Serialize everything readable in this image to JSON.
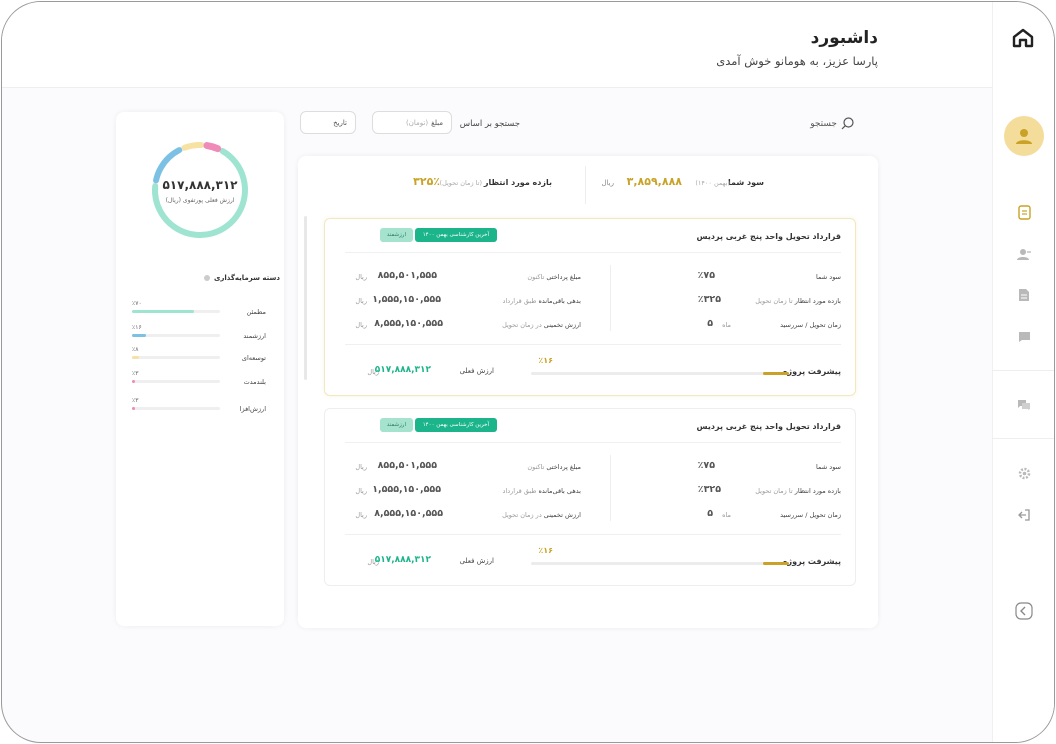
{
  "header": {
    "title": "داشبورد",
    "welcome": "پارسا عزیز، به هومانو خوش آمدی"
  },
  "search": {
    "label": "جستجو",
    "basis_label": "جستجو بر اساس",
    "amount_label": "مبلغ",
    "amount_placeholder": "(تومان)",
    "date_label": "تاریخ"
  },
  "summary": {
    "profit_label": "سود شما",
    "profit_note": "(بهمن ۱۴۰۰)",
    "profit_value": "۳,۸۵۹,۸۸۸",
    "profit_unit": "ریال",
    "return_label": "بازده مورد انتظار",
    "return_note": "(تا زمان تحویل)",
    "return_value": "۳۲۵٪"
  },
  "cards": [
    {
      "title": "قرارداد تحویل واحد پنج غربی پردیس",
      "badge_status": "آخرین کارشناسی بهمن ۱۴۰۰",
      "badge_type": "ارزشمند",
      "profit_label": "سود شما",
      "profit_value": "٪۷۵",
      "return_label": "بازده مورد انتظار",
      "return_note": "تا زمان تحویل",
      "return_value": "٪۳۲۵",
      "delivery_label": "زمان تحویل / سررسید",
      "delivery_value": "۵",
      "delivery_unit": "ماه",
      "paid_label": "مبلغ پرداختی",
      "paid_note": "تاکنون",
      "paid_value": "۸۵۵,۵۰۱,۵۵۵",
      "debt_label": "بدهی باقی‌مانده",
      "debt_note": "طبق قرارداد",
      "debt_value": "۱,۵۵۵,۱۵۰,۵۵۵",
      "estimate_label": "ارزش تخمینی",
      "estimate_note": "در زمان تحویل",
      "estimate_value": "۸,۵۵۵,۱۵۰,۵۵۵",
      "unit": "ریال",
      "progress_label": "پیشرفت پروژه",
      "progress_pct": "٪۱۶",
      "progress_fraction": 0.1,
      "current_label": "ارزش فعلی",
      "current_value": "۵۱۷,۸۸۸,۳۱۲"
    },
    {
      "title": "قرارداد تحویل واحد پنج غربی پردیس",
      "badge_status": "آخرین کارشناسی بهمن ۱۴۰۰",
      "badge_type": "ارزشمند",
      "profit_label": "سود شما",
      "profit_value": "٪۷۵",
      "return_label": "بازده مورد انتظار",
      "return_note": "تا زمان تحویل",
      "return_value": "٪۳۲۵",
      "delivery_label": "زمان تحویل / سررسید",
      "delivery_value": "۵",
      "delivery_unit": "ماه",
      "paid_label": "مبلغ پرداختی",
      "paid_note": "تاکنون",
      "paid_value": "۸۵۵,۵۰۱,۵۵۵",
      "debt_label": "بدهی باقی‌مانده",
      "debt_note": "طبق قرارداد",
      "debt_value": "۱,۵۵۵,۱۵۰,۵۵۵",
      "estimate_label": "ارزش تخمینی",
      "estimate_note": "در زمان تحویل",
      "estimate_value": "۸,۵۵۵,۱۵۰,۵۵۵",
      "unit": "ریال",
      "progress_label": "پیشرفت پروژه",
      "progress_pct": "٪۱۶",
      "progress_fraction": 0.1,
      "current_label": "ارزش فعلی",
      "current_value": "۵۱۷,۸۸۸,۳۱۲"
    }
  ],
  "portfolio": {
    "value": "۵۱۷,۸۸۸,۳۱۲",
    "caption": "ارزش فعلی پورتفوی (ریال)",
    "category_title": "دسته سرمایه‌گذاری",
    "categories": [
      {
        "name": "مطمئن",
        "pct": "٪۷۰",
        "value": 0.7,
        "color": "#9ee4d1"
      },
      {
        "name": "ارزشمند",
        "pct": "٪۱۶",
        "value": 0.16,
        "color": "#7cc1e4"
      },
      {
        "name": "توسعه‌ای",
        "pct": "٪۸",
        "value": 0.08,
        "color": "#f6e3a3"
      },
      {
        "name": "بلندمدت",
        "pct": "٪۳",
        "value": 0.03,
        "color": "#f08ab8"
      },
      {
        "name": "ارزش‌افزا",
        "pct": "٪۳",
        "value": 0.03,
        "color": "#f08ab8"
      }
    ]
  },
  "colors": {
    "accent_gold": "#c9a227",
    "accent_green": "#1cb48a",
    "avatar_bg": "#f4dc9a"
  },
  "icons": [
    "home-logo-icon",
    "user-icon",
    "document-icon",
    "user-transfer-icon",
    "file-icon",
    "chat-icon",
    "messages-icon",
    "settings-icon",
    "logout-icon",
    "collapse-icon",
    "search-icon"
  ]
}
